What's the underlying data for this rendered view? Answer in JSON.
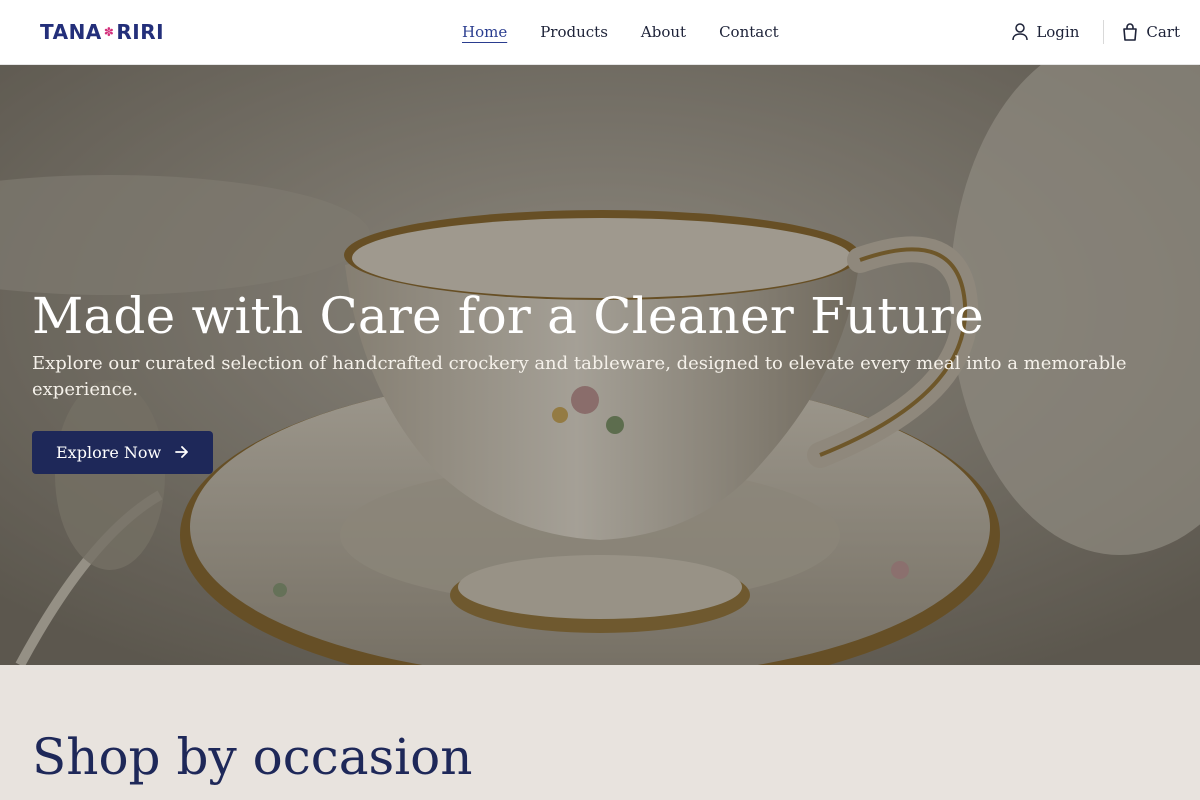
{
  "header": {
    "brand": {
      "left": "TANA",
      "right": "RIRI",
      "mark": "flower-icon"
    },
    "nav": [
      {
        "label": "Home",
        "active": true
      },
      {
        "label": "Products",
        "active": false
      },
      {
        "label": "About",
        "active": false
      },
      {
        "label": "Contact",
        "active": false
      }
    ],
    "login_label": "Login",
    "cart_label": "Cart"
  },
  "hero": {
    "title": "Made with Care for a Cleaner Future",
    "subtitle": "Explore our curated selection of handcrafted crockery and tableware, designed to elevate every meal into a memorable experience.",
    "cta_label": "Explore Now",
    "cta_icon": "arrow-right-icon",
    "image": "porcelain teacup"
  },
  "section": {
    "title": "Shop by occasion"
  },
  "colors": {
    "brand": "#232f7a",
    "accent": "#d32f7b",
    "cta_bg": "#1e2859",
    "section_bg": "#e8e3de"
  }
}
